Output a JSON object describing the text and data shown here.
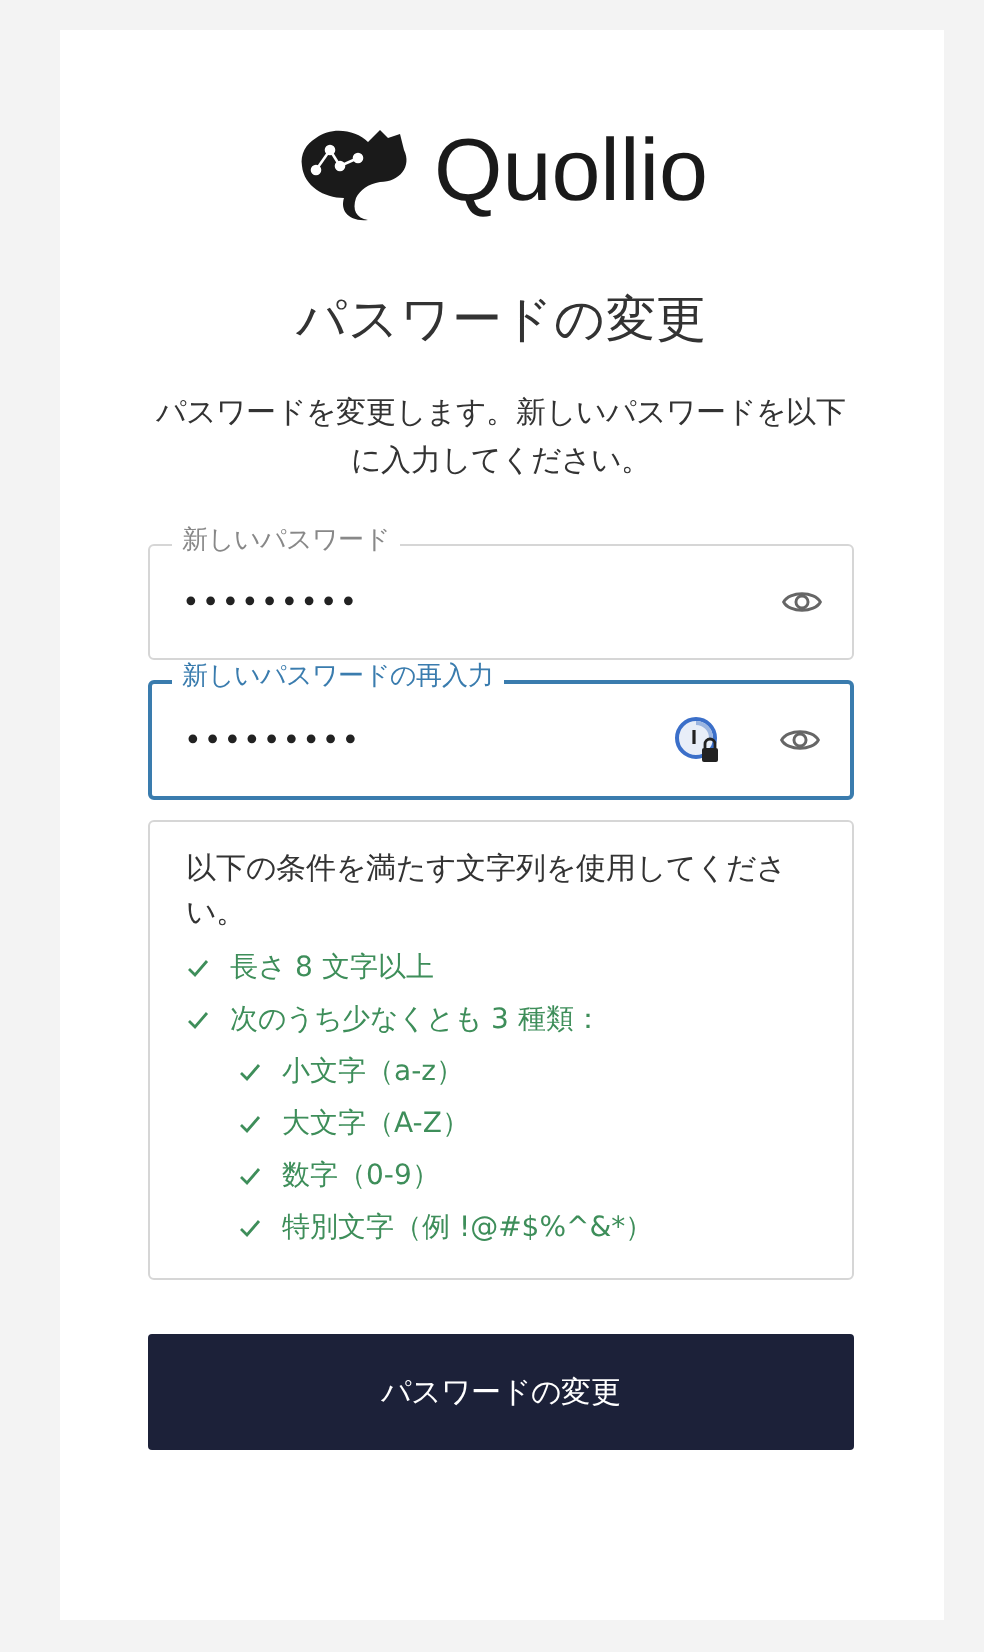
{
  "logo": {
    "text": "Quollio"
  },
  "title": "パスワードの変更",
  "description": "パスワードを変更します。新しいパスワードを以下に入力してください。",
  "fields": [
    {
      "label": "新しいパスワード",
      "value": "•••••••••",
      "focused": false,
      "manager_icon": false
    },
    {
      "label": "新しいパスワードの再入力",
      "value": "•••••••••",
      "focused": true,
      "manager_icon": true
    }
  ],
  "requirements": {
    "intro": "以下の条件を満たす文字列を使用してください。",
    "items": [
      {
        "text": "長さ 8 文字以上",
        "met": true
      },
      {
        "text": "次のうち少なくとも 3 種類：",
        "met": true,
        "children": [
          {
            "text": "小文字（a-z）",
            "met": true
          },
          {
            "text": "大文字（A-Z）",
            "met": true
          },
          {
            "text": "数字（0-9）",
            "met": true
          },
          {
            "text": "特別文字（例 !@#$%^&*）",
            "met": true
          }
        ]
      }
    ]
  },
  "submit": {
    "label": "パスワードの変更"
  }
}
